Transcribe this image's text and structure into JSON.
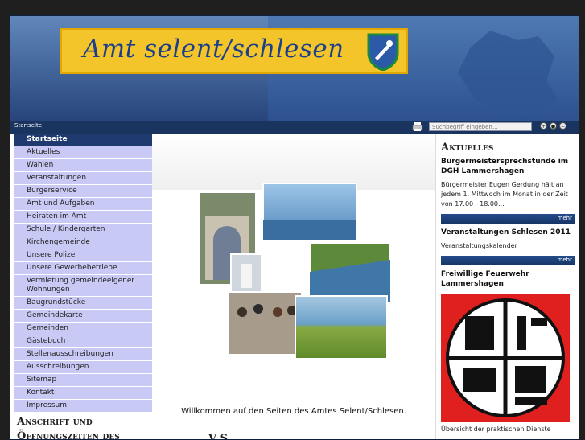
{
  "header": {
    "banner_title": "Amt selent/schlesen"
  },
  "navbar": {
    "breadcrumb": "Startseite",
    "search": {
      "placeholder": "Suchbegriff eingeben..."
    },
    "zoom": {
      "plus": "+",
      "reset": "●",
      "minus": "−"
    }
  },
  "sidebar": {
    "items": [
      {
        "label": "Startseite",
        "active": true
      },
      {
        "label": "Aktuelles"
      },
      {
        "label": "Wahlen"
      },
      {
        "label": "Veranstaltungen"
      },
      {
        "label": "Bürgerservice"
      },
      {
        "label": "Amt und Aufgaben"
      },
      {
        "label": "Heiraten im Amt"
      },
      {
        "label": "Schule / Kindergarten"
      },
      {
        "label": "Kirchengemeinde"
      },
      {
        "label": "Unsere Polizei"
      },
      {
        "label": "Unsere Gewerbebetriebe"
      },
      {
        "label": "Vermietung gemeindeeigener Wohnungen"
      },
      {
        "label": "Baugrundstücke"
      },
      {
        "label": "Gemeindekarte"
      },
      {
        "label": "Gemeinden"
      },
      {
        "label": "Gästebuch"
      },
      {
        "label": "Stellenausschreibungen"
      },
      {
        "label": "Ausschreibungen"
      },
      {
        "label": "Sitemap"
      },
      {
        "label": "Kontakt"
      },
      {
        "label": "Impressum"
      }
    ],
    "address_heading": "Anschrift und Öffnungszeiten des Amtes Selent/Schlesen"
  },
  "main": {
    "welcome": "Willkommen auf den Seiten des Amtes Selent/Schlesen.",
    "welcome_cut": "V                          S"
  },
  "right": {
    "heading": "Aktuelles",
    "news1": {
      "title": "Bürgermeistersprechstunde im DGH Lammershagen",
      "text": "Bürgermeister Eugen Gerdung hält an jedem 1. Mittwoch im Monat in der Zeit von 17.00 - 18.00...",
      "more": "mehr"
    },
    "news2": {
      "title": "Veranstaltungen Schlesen 2011",
      "text": "Veranstaltungskalender",
      "more": "mehr"
    },
    "news3": {
      "title": "Freiwillige Feuerwehr Lammershagen",
      "caption": "Übersicht der praktischen Dienste"
    }
  },
  "colors": {
    "nav_dark": "#18345f",
    "menu_bg": "#c9c9f5",
    "banner": "#f4c52a",
    "title_blue": "#1c3f8b",
    "fire_red": "#e01f1f"
  }
}
